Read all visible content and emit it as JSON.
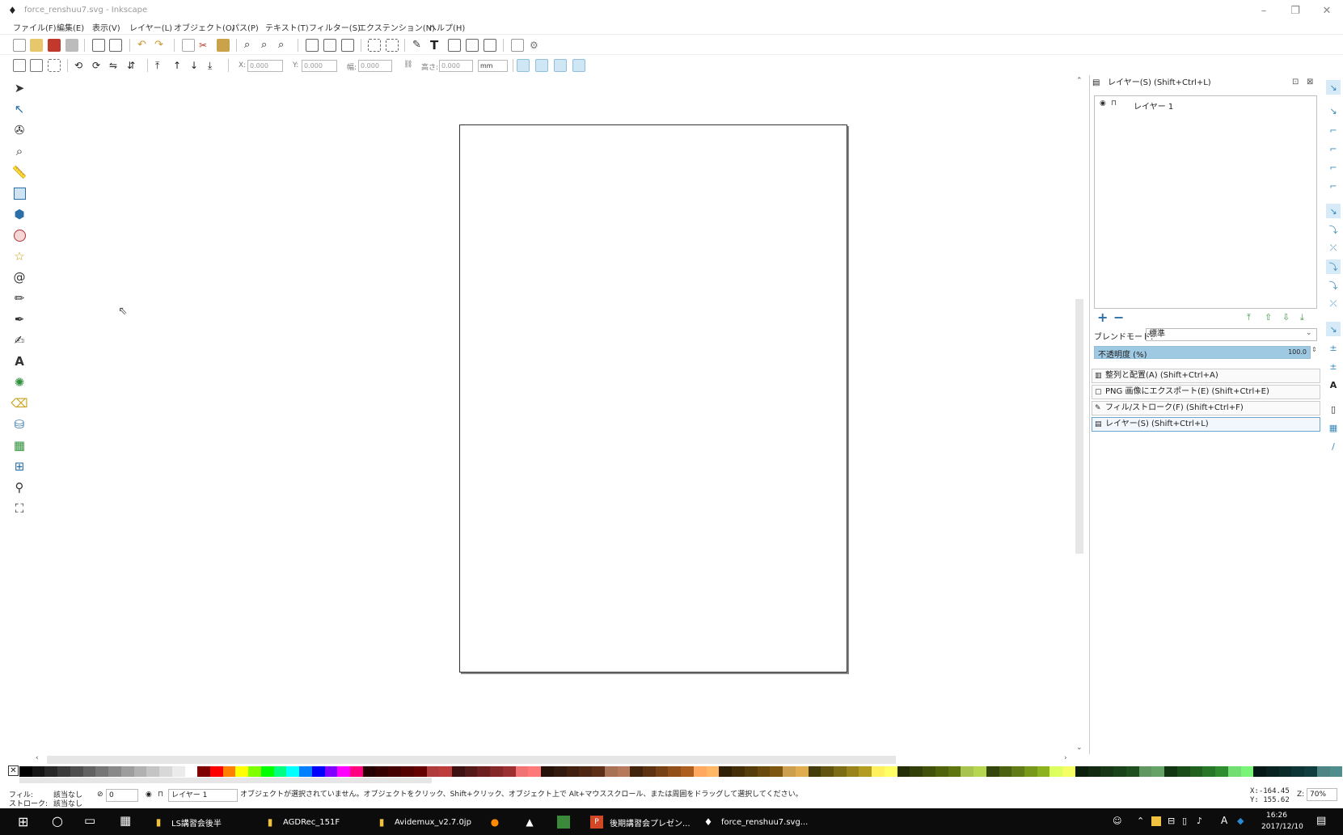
{
  "window": {
    "title": "force_renshuu7.svg - Inkscape",
    "controls": [
      "–",
      "❐",
      "✕"
    ]
  },
  "menu": [
    "ファイル(F)",
    "編集(E)",
    "表示(V)",
    "レイヤー(L)",
    "オブジェクト(O)",
    "パス(P)",
    "テキスト(T)",
    "フィルター(S)",
    "エクステンション(N)",
    "ヘルプ(H)"
  ],
  "toolbar2": {
    "x_label": "X:",
    "x_value": "0.000",
    "y_label": "Y:",
    "y_value": "0.000",
    "w_label": "幅:",
    "w_value": "0.000",
    "h_label": "高さ:",
    "h_value": "0.000",
    "unit": "mm"
  },
  "layers_panel": {
    "title": "レイヤー(S) (Shift+Ctrl+L)",
    "layers": [
      {
        "name": "レイヤー 1",
        "visible_icon": "eye-icon",
        "lock_icon": "unlock-icon"
      }
    ],
    "blend_label": "ブレンドモード:",
    "blend_value": "標準",
    "opacity_label": "不透明度 (%)",
    "opacity_value": "100.0",
    "add_symbol": "+",
    "remove_symbol": "−"
  },
  "docked_dialogs": [
    {
      "label": "整列と配置(A) (Shift+Ctrl+A)",
      "icon": "align-icon"
    },
    {
      "label": "PNG 画像にエクスポート(E) (Shift+Ctrl+E)",
      "icon": "export-icon"
    },
    {
      "label": "フィル/ストローク(F) (Shift+Ctrl+F)",
      "icon": "fill-stroke-icon"
    },
    {
      "label": "レイヤー(S) (Shift+Ctrl+L)",
      "icon": "layers-icon"
    }
  ],
  "status": {
    "fill_label": "フィル:",
    "fill_value": "該当なし",
    "stroke_label": "ストローク:",
    "stroke_value": "該当なし",
    "opacity_value": "0",
    "layer_value": "レイヤー 1",
    "message": "オブジェクトが選択されていません。オブジェクトをクリック、Shift+クリック、オブジェクト上で Alt+マウススクロール、または周囲をドラッグして選択してください。",
    "x_coord": "X:-164.45",
    "y_coord": "Y: 155.62",
    "zoom_label": "Z:",
    "zoom_value": "70%"
  },
  "taskbar": {
    "items": [
      {
        "label": "LS講習会後半",
        "icon": "folder-icon"
      },
      {
        "label": "AGDRec_151F",
        "icon": "folder-icon"
      },
      {
        "label": "Avidemux_v2.7.0jp",
        "icon": "folder-icon"
      },
      {
        "label": "",
        "icon": "firefox-icon"
      },
      {
        "label": "",
        "icon": "app-icon"
      },
      {
        "label": "",
        "icon": "green-app-icon"
      },
      {
        "label": "後期講習会プレゼン...",
        "icon": "powerpoint-icon"
      },
      {
        "label": "force_renshuu7.svg...",
        "icon": "inkscape-icon"
      }
    ],
    "ime": "A",
    "time": "16:26",
    "date": "2017/12/10"
  },
  "colors": {
    "accent": "#3a8ab8",
    "opacity_fill": "#9fc9e3",
    "taskbar": "#0c0c0c"
  }
}
